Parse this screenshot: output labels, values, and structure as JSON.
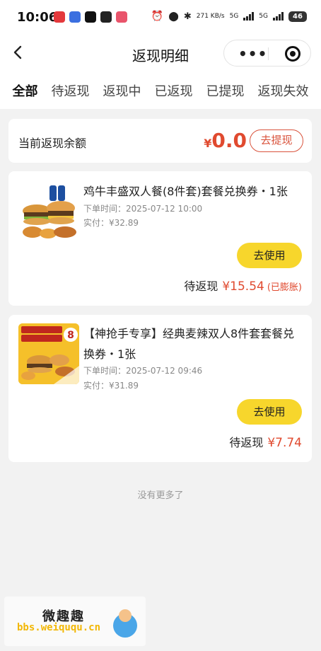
{
  "status_bar": {
    "time": "10:06",
    "network_speed": "271 KB/s",
    "network_1": "5G",
    "network_2": "5G",
    "battery": "46"
  },
  "nav": {
    "title": "返现明细",
    "more_label": "•••",
    "back_icon": "chevron-left-icon",
    "target_icon": "target-icon"
  },
  "tabs": [
    "全部",
    "待返现",
    "返现中",
    "已返现",
    "已提现",
    "返现失效"
  ],
  "balance": {
    "label": "当前返现余额",
    "currency": "¥",
    "amount": "0.0",
    "withdraw_label": "去提现"
  },
  "orders": [
    {
      "title": "鸡牛丰盛双人餐(8件套)套餐兑换券・1张",
      "order_time": "下单时间：2025-07-12 10:00",
      "paid": "实付：¥32.89",
      "use_label": "去使用",
      "pending_label": "待返现",
      "pending_amount": "¥15.54",
      "note": "(已膨胀)"
    },
    {
      "title": "【神抢手专享】经典麦辣双人8件套套餐兑换券・1张",
      "order_time": "下单时间：2025-07-12 09:46",
      "paid": "实付：¥31.89",
      "use_label": "去使用",
      "pending_label": "待返现",
      "pending_amount": "¥7.74"
    }
  ],
  "no_more": "没有更多了",
  "watermark": {
    "title": "微趣趣",
    "url": "bbs.weiququ.cn"
  },
  "colors": {
    "accent_red": "#e04a2f",
    "button_yellow": "#f7d62c",
    "background": "#f2f2f2"
  }
}
